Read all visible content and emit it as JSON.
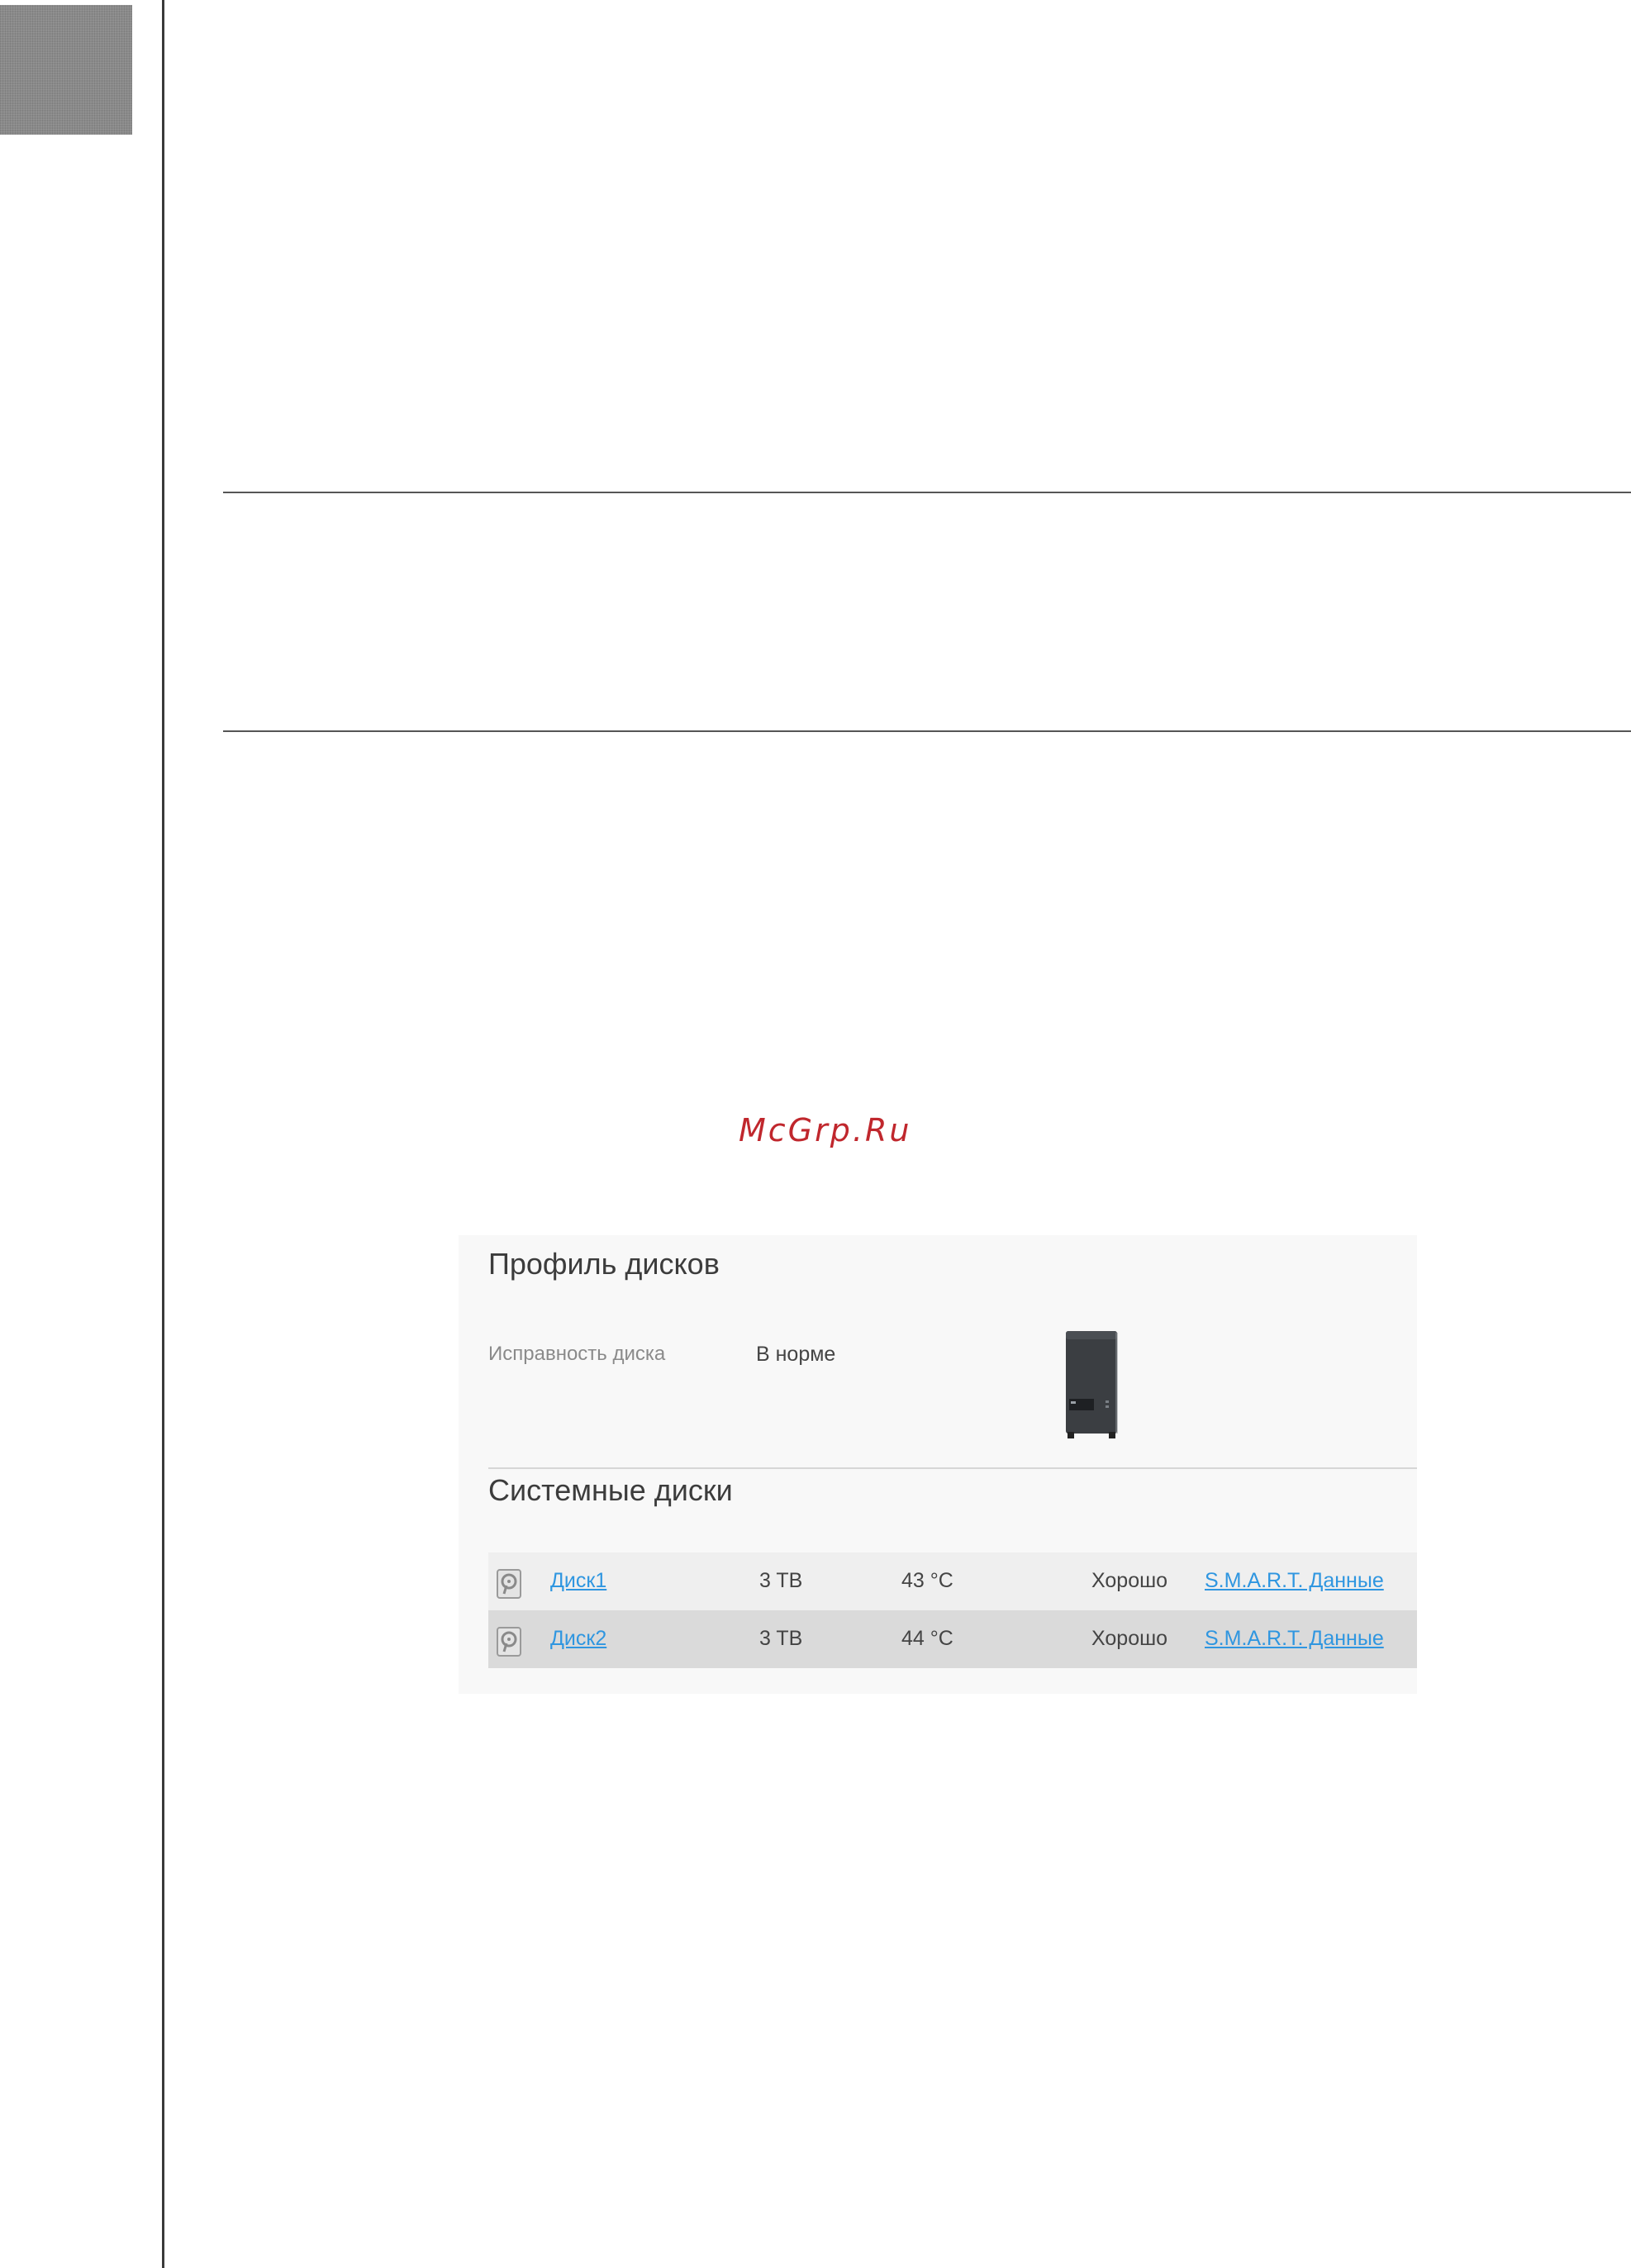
{
  "watermark": "McGrp.Ru",
  "panel": {
    "title": "Профиль дисков",
    "health_label": "Исправность диска",
    "health_value": "В норме",
    "section_title": "Системные диски",
    "disks": [
      {
        "name": "Диск1",
        "size": "3 TB",
        "temperature": "43 °C",
        "status": "Хорошо",
        "smart_link": "S.M.A.R.T. Данные"
      },
      {
        "name": "Диск2",
        "size": "3 TB",
        "temperature": "44 °C",
        "status": "Хорошо",
        "smart_link": "S.M.A.R.T. Данные"
      }
    ]
  },
  "colors": {
    "link": "#2f96e0",
    "watermark": "#c0272d",
    "panel_background": "#f8f8f8"
  },
  "icons": {
    "disk": "hard-disk-icon",
    "device": "nas-device-image"
  }
}
